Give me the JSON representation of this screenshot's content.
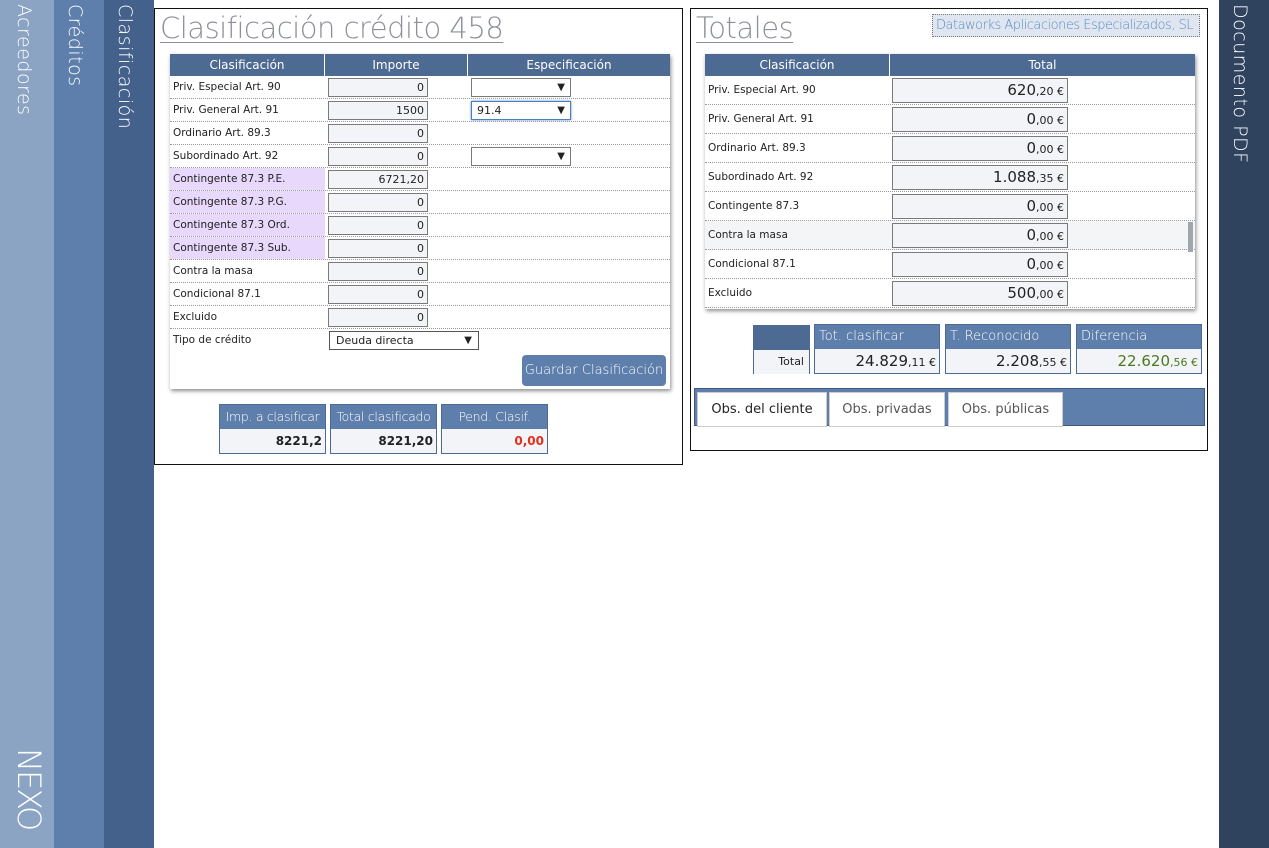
{
  "rails": {
    "acreedores": "Acreedores",
    "creditos": "Créditos",
    "clasificacion": "Clasificación",
    "documento_pdf": "Documento PDF",
    "logo": "NEXO"
  },
  "left": {
    "title": "Clasificación crédito 458",
    "headers": [
      "Clasificación",
      "Importe",
      "Especificación"
    ],
    "rows": [
      {
        "label": "Priv. Especial Art. 90",
        "value": "0",
        "spec": "",
        "has_select": true,
        "pink": false
      },
      {
        "label": "Priv. General Art. 91",
        "value": "1500",
        "spec": "91.4",
        "has_select": true,
        "pink": false
      },
      {
        "label": "Ordinario Art. 89.3",
        "value": "0",
        "spec": "",
        "has_select": false,
        "pink": false
      },
      {
        "label": "Subordinado Art. 92",
        "value": "0",
        "spec": "",
        "has_select": true,
        "pink": false
      },
      {
        "label": "Contingente 87.3 P.E.",
        "value": "6721,20",
        "spec": "",
        "has_select": false,
        "pink": true
      },
      {
        "label": "Contingente 87.3 P.G.",
        "value": "0",
        "spec": "",
        "has_select": false,
        "pink": true
      },
      {
        "label": "Contingente 87.3 Ord.",
        "value": "0",
        "spec": "",
        "has_select": false,
        "pink": true
      },
      {
        "label": "Contingente 87.3 Sub.",
        "value": "0",
        "spec": "",
        "has_select": false,
        "pink": true
      },
      {
        "label": "Contra la masa",
        "value": "0",
        "spec": "",
        "has_select": false,
        "pink": false
      },
      {
        "label": "Condicional 87.1",
        "value": "0",
        "spec": "",
        "has_select": false,
        "pink": false
      },
      {
        "label": "Excluido",
        "value": "0",
        "spec": "",
        "has_select": false,
        "pink": false
      }
    ],
    "tipo_label": "Tipo de crédito",
    "tipo_value": "Deuda directa",
    "save_label": "Guardar Clasificación",
    "summary": [
      {
        "label": "Imp. a clasificar",
        "value": "8221,2",
        "color": "#222222"
      },
      {
        "label": "Total clasificado",
        "value": "8221,20",
        "color": "#222222"
      },
      {
        "label": "Pend. Clasif.",
        "value": "0,00",
        "color": "#e0301e"
      }
    ]
  },
  "right": {
    "title": "Totales",
    "company": "Dataworks Aplicaciones Especializados, SL",
    "headers": [
      "Clasificación",
      "Total"
    ],
    "rows": [
      {
        "label": "Priv. Especial Art. 90",
        "int": "620",
        "dec": ",20 €"
      },
      {
        "label": "Priv. General Art. 91",
        "int": "0",
        "dec": ",00 €"
      },
      {
        "label": "Ordinario Art. 89.3",
        "int": "0",
        "dec": ",00 €"
      },
      {
        "label": "Subordinado Art. 92",
        "int": "1.088",
        "dec": ",35 €"
      },
      {
        "label": "Contingente 87.3",
        "int": "0",
        "dec": ",00 €"
      },
      {
        "label": "Contra la masa",
        "int": "0",
        "dec": ",00 €"
      },
      {
        "label": "Condicional 87.1",
        "int": "0",
        "dec": ",00 €"
      },
      {
        "label": "Excluido",
        "int": "500",
        "dec": ",00 €"
      }
    ],
    "total_label": "Total",
    "summary": [
      {
        "label": "Tot. clasificar",
        "int": "24.829",
        "dec": ",11 €",
        "color": "#222222"
      },
      {
        "label": "T. Reconocido",
        "int": "2.208",
        "dec": ",55 €",
        "color": "#222222"
      },
      {
        "label": "Diferencia",
        "int": "22.620",
        "dec": ",56 €",
        "color": "#4a7a1e"
      }
    ],
    "tabs": [
      "Obs. del cliente",
      "Obs. privadas",
      "Obs. públicas"
    ],
    "active_tab": 0
  }
}
